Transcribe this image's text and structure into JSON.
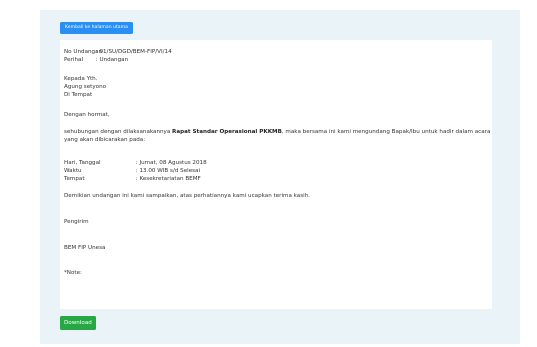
{
  "back_button": {
    "label": "Kembali ke halaman utama"
  },
  "header": {
    "no_label": "No Undangan",
    "no_value": ": 01/SU/DGD/BEM-FIP/VI/14",
    "perihal_label": "Perihal",
    "perihal_value": ": Undangan"
  },
  "recipient": {
    "line1": "Kepada Yth.",
    "line2": "Agung setyono",
    "line3": "Di Tempat"
  },
  "greeting": "Dengan hormat,",
  "body": {
    "pre": "sehubungan dengan dilaksanakannya ",
    "bold": "Rapat Standar Operasional PKKMB",
    "post": ", maka bersama ini kami mengundang Bapak/Ibu untuk hadir dalam acara yang akan dibicarakan pada:"
  },
  "details": {
    "date_label": "Hari, Tanggal",
    "date_value": ": Jumat, 08 Agustus 2018",
    "time_label": "Waktu",
    "time_value": ": 13.00 WIB s/d Selesai",
    "place_label": "Tempat",
    "place_value": ": Kesekretariatan BEMF"
  },
  "closing": "Demikian undangan ini kami sampaikan, atas perhatiannya kami ucapkan terima kasih.",
  "signature": {
    "sender_label": "Pengirim",
    "sender_value": "BEM FIP Unesa"
  },
  "note": "*Note:",
  "download_button": {
    "label": "Download"
  }
}
